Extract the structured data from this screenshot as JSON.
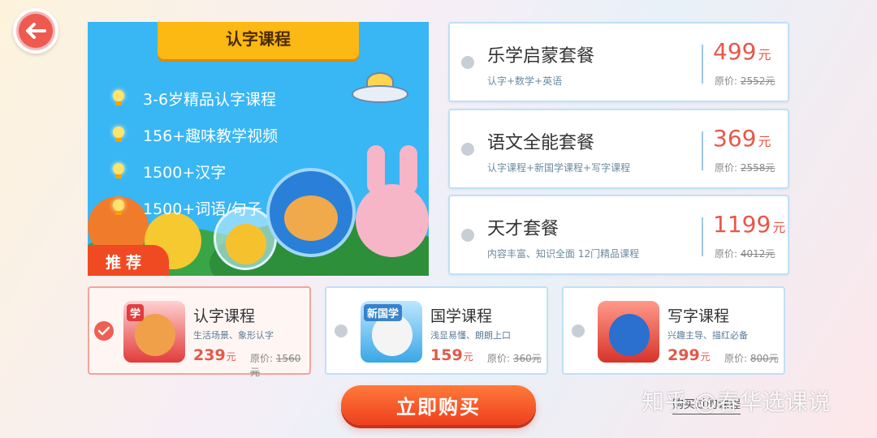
{
  "header": {
    "back_icon": "arrow-left-icon"
  },
  "banner": {
    "title": "认字课程",
    "features": [
      "3-6岁精品认字课程",
      "156+趣味教学视频",
      "1500+汉字",
      "1500+词语/句子"
    ],
    "recommend_tag": "推荐"
  },
  "packages": [
    {
      "name": "乐学启蒙套餐",
      "desc": "认字+数学+英语",
      "price": "499",
      "unit": "元",
      "orig_label": "原价:",
      "orig_price": "2552元"
    },
    {
      "name": "语文全能套餐",
      "desc": "认字课程+新国学课程+写字课程",
      "price": "369",
      "unit": "元",
      "orig_label": "原价:",
      "orig_price": "2558元"
    },
    {
      "name": "天才套餐",
      "desc": "内容丰富、知识全面 12门精品课程",
      "price": "1199",
      "unit": "元",
      "orig_label": "原价:",
      "orig_price": "4012元"
    }
  ],
  "courses": [
    {
      "name": "认字课程",
      "desc": "生活场景、象形认字",
      "price": "239",
      "unit": "元",
      "orig_label": "原价:",
      "orig_price": "1560元",
      "thumb_label": "学",
      "selected": true
    },
    {
      "name": "国学课程",
      "desc": "浅显易懂、朗朗上口",
      "price": "159",
      "unit": "元",
      "orig_label": "原价:",
      "orig_price": "360元",
      "thumb_label": "新国学",
      "selected": false
    },
    {
      "name": "写字课程",
      "desc": "兴趣主导、描红必备",
      "price": "299",
      "unit": "元",
      "orig_label": "原价:",
      "orig_price": "800元",
      "thumb_label": "",
      "selected": false
    }
  ],
  "actions": {
    "buy_label": "立即购买",
    "purchased_label": "购买过的课程"
  },
  "watermark": "知乎 @春华选课说",
  "colors": {
    "accent": "#ee3f1e",
    "price": "#e5584a",
    "card_border": "#bfe0f6",
    "banner_bg": "#39b6f4",
    "title_bg": "#fcb813"
  }
}
